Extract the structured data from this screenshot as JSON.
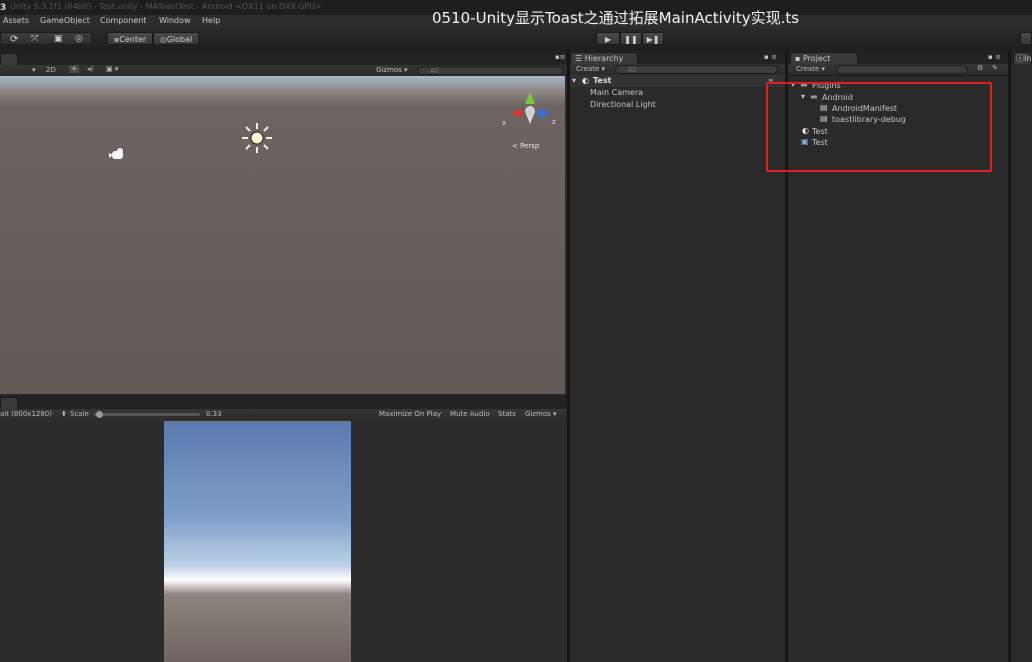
{
  "titlebar": {
    "app_icon": "3",
    "window_title": "Unity 5.3.1f1 (64bit) - Test.unity - MAToastTest - Android <DX11 on DX9 GPU>",
    "video_title": "0510-Unity显示Toast之通过拓展MainActivity实现.ts"
  },
  "menu": [
    "Assets",
    "GameObject",
    "Component",
    "Window",
    "Help"
  ],
  "toolbar": {
    "pivot_label": "Center",
    "space_label": "Global"
  },
  "scene": {
    "mode_2d": "2D",
    "gizmos_label": "Gizmos ▾",
    "search_placeholder": "All",
    "persp_label": "< Persp",
    "axis_x": "x",
    "axis_z": "z"
  },
  "game": {
    "resolution": "ait (800x1280)",
    "scale_label": "Scale",
    "scale_value": "0.33",
    "scale_fraction": 0.33,
    "maximize_label": "Maximize On Play",
    "mute_label": "Mute Audio",
    "stats_label": "Stats",
    "gizmos_label": "Gizmos ▾"
  },
  "hierarchy": {
    "tab_label": "Hierarchy",
    "create_label": "Create ▾",
    "search_placeholder": "All",
    "scene_name": "Test",
    "items": [
      "Main Camera",
      "Directional Light"
    ]
  },
  "project": {
    "tab_label": "Project",
    "create_label": "Create ▾",
    "tree": {
      "plugins": "Plugins",
      "android": "Android",
      "manifest": "AndroidManifest",
      "library": "toastlibrary-debug",
      "scene_asset": "Test",
      "script_asset": "Test"
    }
  },
  "inspector": {
    "tab_label": "In"
  },
  "colors": {
    "highlight": "#e0201c",
    "accent": "#3a6fb0"
  }
}
